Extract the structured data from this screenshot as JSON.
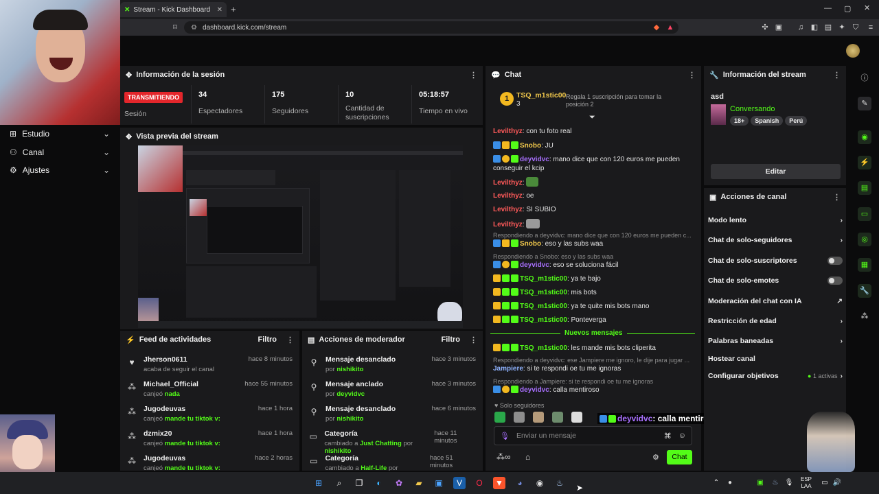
{
  "browser": {
    "tab_title": "Stream - Kick Dashboard",
    "url": "dashboard.kick.com/stream"
  },
  "nav": {
    "items": [
      {
        "label": "Estudio"
      },
      {
        "label": "Canal"
      },
      {
        "label": "Ajustes"
      }
    ]
  },
  "session": {
    "title": "Información de la sesión",
    "status_badge": "TRANSMITIENDO",
    "status_label": "Sesión",
    "stats": [
      {
        "value": "34",
        "label": "Espectadores"
      },
      {
        "value": "175",
        "label": "Seguidores"
      },
      {
        "value": "10",
        "label": "Cantidad de suscripciones"
      },
      {
        "value": "05:18:57",
        "label": "Tiempo en vivo"
      }
    ]
  },
  "preview": {
    "title": "Vista previa del stream"
  },
  "activity": {
    "title": "Feed de actividades",
    "filter": "Filtro",
    "items": [
      {
        "icon": "heart-icon",
        "name": "Jherson0611",
        "desc": "acaba de seguir el canal",
        "reward": "",
        "time": "hace 8 minutos"
      },
      {
        "icon": "kick-points-icon",
        "name": "Michael_Official",
        "desc": "canjeó ",
        "reward": "nada",
        "time": "hace 55 minutos"
      },
      {
        "icon": "kick-points-icon",
        "name": "Jugodeuvas",
        "desc": "canjeó ",
        "reward": "mande tu tiktok v:",
        "time": "hace 1 hora"
      },
      {
        "icon": "kick-points-icon",
        "name": "dzmix20",
        "desc": "canjeó ",
        "reward": "mande tu tiktok v:",
        "time": "hace 1 hora"
      },
      {
        "icon": "kick-points-icon",
        "name": "Jugodeuvas",
        "desc": "canjeó ",
        "reward": "mande tu tiktok v:",
        "time": "hace 2 horas"
      }
    ]
  },
  "moderator": {
    "title": "Acciones de moderador",
    "filter": "Filtro",
    "items": [
      {
        "icon": "unpin-icon",
        "title": "Mensaje desanclado",
        "pre": "por ",
        "who": "nishikito",
        "mid": "",
        "who2": "",
        "time": "hace 3 minutos"
      },
      {
        "icon": "pin-icon",
        "title": "Mensaje anclado",
        "pre": "por ",
        "who": "deyvidvc",
        "mid": "",
        "who2": "",
        "time": "hace 3 minutos"
      },
      {
        "icon": "unpin-icon",
        "title": "Mensaje desanclado",
        "pre": "por ",
        "who": "nishikito",
        "mid": "",
        "who2": "",
        "time": "hace 6 minutos"
      },
      {
        "icon": "category-icon",
        "title": "Categoría",
        "pre": "cambiado a ",
        "who": "Just Chatting",
        "mid": " por ",
        "who2": "nishikito",
        "time": "hace 11 minutos"
      },
      {
        "icon": "category-icon",
        "title": "Categoría",
        "pre": "cambiado a ",
        "who": "Half-Life",
        "mid": " por ",
        "who2": "nishikito",
        "time": "hace 51 minutos"
      }
    ]
  },
  "chat": {
    "title": "Chat",
    "pinned_user": "TSQ_m1stic00",
    "pinned_count": "3",
    "pinned_gift": "Regala 1 suscripción para tomar la posición 2",
    "messages": [
      {
        "user": "Levilthyz",
        "color": "#ff5a5a",
        "text": ": con tu foto real"
      },
      {
        "user": "Snobo",
        "color": "#f2c94c",
        "text": ": JU"
      },
      {
        "user": "deyvidvc",
        "color": "#a970ff",
        "text": ": mano dice que con 120 euros me pueden conseguir el kcip"
      },
      {
        "user": "Levilthyz",
        "color": "#ff5a5a",
        "text": ":"
      },
      {
        "user": "Levilthyz",
        "color": "#ff5a5a",
        "text": ": oe"
      },
      {
        "user": "Levilthyz",
        "color": "#ff5a5a",
        "text": ": SI SUBIO"
      },
      {
        "user": "Levilthyz",
        "color": "#ff5a5a",
        "text": ":"
      }
    ],
    "reply1": "Respondiendo a deyvidvc: mano dice que con 120 euros me pueden c...",
    "msg_snobo": {
      "user": "Snobo",
      "text": ": eso y las subs waa"
    },
    "reply2": "Respondiendo a Snobo: eso y las subs waa",
    "msg_deyvid": {
      "user": "deyvidvc",
      "text": ": eso se soluciona fácil"
    },
    "tsq_msgs": [
      {
        "user": "TSQ_m1stic00",
        "text": ": ya te bajo"
      },
      {
        "user": "TSQ_m1stic00",
        "text": ": mis bots"
      },
      {
        "user": "TSQ_m1stic00",
        "text": ": ya te quite mis bots mano"
      },
      {
        "user": "TSQ_m1stic00",
        "text": ": Ponteverga"
      }
    ],
    "new_messages": "Nuevos mensajes",
    "msg_after_new": {
      "user": "TSQ_m1stic00",
      "text": ": les mande mis bots cliperita"
    },
    "reply3": "Respondiendo a deyvidvc: ese Jampiere me ignoro, le dije para jugar ...",
    "msg_jampiere": {
      "user": "Jampiere",
      "text": ": si te respondi oe tu me ignoras"
    },
    "reply4": "Respondiendo a Jampiere: si te respondi oe tu me ignoras",
    "msg_last": {
      "user": "deyvidvc",
      "text": ": calla mentiroso"
    },
    "followers_only": "Solo seguidores",
    "overlay_user": "deyvidvc",
    "overlay_text": ": calla mentiroso",
    "input_placeholder": "Enviar un mensaje",
    "send": "Chat"
  },
  "stream_info": {
    "title": "Información del stream",
    "stream_title": "asd",
    "category": "Conversando",
    "tags": [
      "18+",
      "Spanish",
      "Perú"
    ],
    "edit": "Editar"
  },
  "channel_actions": {
    "title": "Acciones de canal",
    "items": [
      {
        "label": "Modo lento",
        "control": "chevron"
      },
      {
        "label": "Chat de solo-seguidores",
        "control": "chevron"
      },
      {
        "label": "Chat de solo-suscriptores",
        "control": "toggle"
      },
      {
        "label": "Chat de solo-emotes",
        "control": "toggle"
      },
      {
        "label": "Moderación del chat con IA",
        "control": "external"
      },
      {
        "label": "Restricción de edad",
        "control": "chevron"
      },
      {
        "label": "Palabras baneadas",
        "control": "chevron"
      },
      {
        "label": "Hostear canal",
        "control": "none"
      },
      {
        "label": "Configurar objetivos",
        "control": "chevron"
      }
    ],
    "goals_active": "1 activas"
  },
  "taskbar": {
    "lang": "ESP",
    "lang2": "LAA"
  },
  "colors": {
    "accent": "#53fc18",
    "live": "#e3262b",
    "panel": "#1a1a1c"
  }
}
